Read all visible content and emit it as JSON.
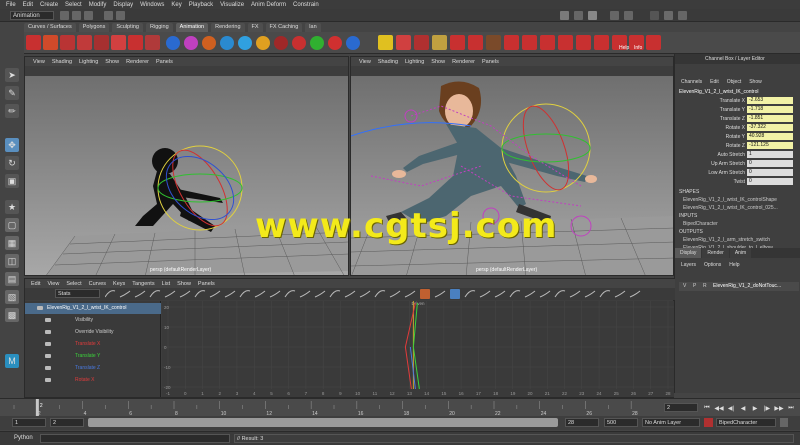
{
  "menubar": [
    "File",
    "Edit",
    "Create",
    "Select",
    "Modify",
    "Display",
    "Windows",
    "Key",
    "Playback",
    "Visualize",
    "Anim Deform",
    "Constrain"
  ],
  "status_line": {
    "mode": "Animation"
  },
  "shelf_tabs": [
    "Curves / Surfaces",
    "Polygons",
    "Sculpting",
    "Rigging",
    "Animation",
    "Rendering",
    "FX",
    "FX Caching",
    "",
    "",
    "",
    "",
    "",
    "",
    "",
    "lan"
  ],
  "shelf_labels": {
    "help": "Help",
    "info": "Info"
  },
  "viewport_left": {
    "menu": [
      "View",
      "Shading",
      "Lighting",
      "Show",
      "Renderer",
      "Panels"
    ],
    "camera_label": "persp (defaultRenderLayer)"
  },
  "viewport_right": {
    "menu": [
      "View",
      "Shading",
      "Lighting",
      "Show",
      "Renderer",
      "Panels"
    ],
    "camera_label": "persp (defaultRenderLayer)"
  },
  "watermark": "www.cgtsj.com",
  "channel_box": {
    "title": "Channel Box / Layer Editor",
    "menu": [
      "Channels",
      "Edit",
      "Object",
      "Show"
    ],
    "node": "ElevenRig_V1_2_l_wrist_IK_control",
    "attributes": [
      {
        "label": "Translate X",
        "value": "-2.653"
      },
      {
        "label": "Translate Y",
        "value": "-1.718"
      },
      {
        "label": "Translate Z",
        "value": "-1.851"
      },
      {
        "label": "Rotate X",
        "value": "-37.322"
      },
      {
        "label": "Rotate Y",
        "value": "40.928"
      },
      {
        "label": "Rotate Z",
        "value": "-121.125"
      },
      {
        "label": "Auto Stretch",
        "value": "1"
      },
      {
        "label": "Up Arm Stretch",
        "value": "0"
      },
      {
        "label": "Low Arm Stretch",
        "value": "0"
      },
      {
        "label": "Twist",
        "value": "0"
      }
    ],
    "shapes_header": "SHAPES",
    "shapes": [
      "ElevenRig_V1_2_l_wrist_IK_controlShape",
      "ElevenRig_V1_2_l_wrist_IK_control_025..."
    ],
    "inputs_header": "INPUTS",
    "inputs": [
      "BipedCharacter"
    ],
    "outputs_header": "OUTPUTS",
    "outputs": [
      "ElevenRig_V1_2_l_arm_stretch_switch",
      "ElevenRig_V1_2_l_shoulder_to_l_elbow...",
      "ElevenRig_V1_2_l_elbowIK_stretch_plus..."
    ]
  },
  "layer_editor": {
    "tabs": [
      "Display",
      "Render",
      "Anim"
    ],
    "menu": [
      "Layers",
      "Options",
      "Help"
    ],
    "layer": {
      "v": "V",
      "p": "P",
      "r": "R",
      "name": "ElevenRig_V1_2_doNotTouc..."
    }
  },
  "graph_editor": {
    "menu": [
      "Edit",
      "View",
      "Select",
      "Curves",
      "Keys",
      "Tangents",
      "List",
      "Show",
      "Panels"
    ],
    "stats_label": "Stats",
    "outliner": [
      "ElevenRig_V1_2_l_wrist_IK_control",
      "Visibility",
      "Override Visibility",
      "Translate X",
      "Translate Y",
      "Translate Z",
      "Rotate X"
    ],
    "frame_label": "Driven",
    "x_ticks": [
      "-1",
      "0",
      "1",
      "2",
      "3",
      "4",
      "5",
      "6",
      "7",
      "8",
      "9",
      "10",
      "11",
      "12",
      "13",
      "14",
      "15",
      "16",
      "17",
      "18",
      "19",
      "20",
      "21",
      "22",
      "23",
      "24",
      "25",
      "26",
      "27",
      "28"
    ],
    "y_ticks": [
      "20",
      "10",
      "0",
      "-10",
      "-20"
    ]
  },
  "time_slider": {
    "ticks": [
      "2",
      "4",
      "6",
      "8",
      "10",
      "12",
      "14",
      "16",
      "18",
      "20",
      "22",
      "24",
      "26",
      "28"
    ],
    "current_frame": "2",
    "current_frame_field": "2"
  },
  "range_slider": {
    "start": "1",
    "inner_start": "2",
    "inner_end": "28",
    "end": "500",
    "range_end": "28",
    "anim_layer": "No Anim Layer",
    "character": "BipedCharacter"
  },
  "command_line": {
    "language": "Python",
    "result": "// Result: 3"
  },
  "colors": {
    "watermark": "#f3ea1a",
    "selected_tool": "#5a8fbf",
    "channel_highlight": "#f2f2a6",
    "graph_curve_red": "#e23b3b",
    "graph_curve_green": "#3bd23b"
  }
}
